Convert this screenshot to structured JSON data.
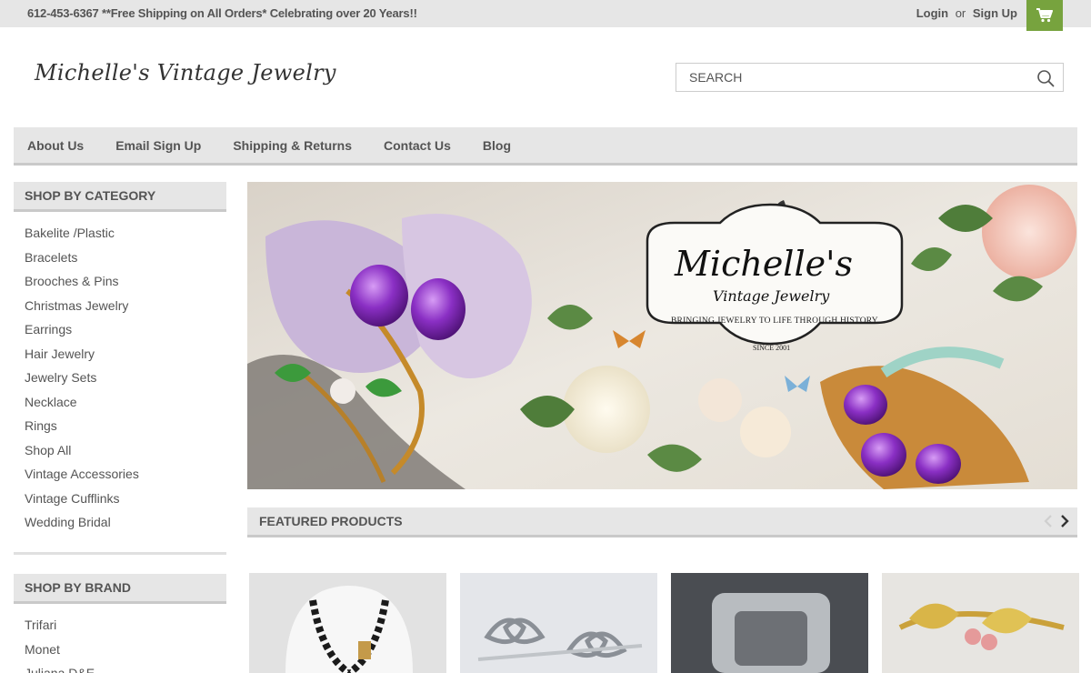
{
  "topbar": {
    "promo": "612-453-6367 **Free Shipping on All Orders* Celebrating over 20 Years!!",
    "login": "Login",
    "or": "or",
    "signup": "Sign Up"
  },
  "header": {
    "logo_text": "Michelle's Vintage Jewelry",
    "search_placeholder": "SEARCH"
  },
  "nav": {
    "items": [
      "About Us",
      "Email Sign Up",
      "Shipping & Returns",
      "Contact Us",
      "Blog"
    ]
  },
  "sidebar": {
    "category_heading": "SHOP BY CATEGORY",
    "categories": [
      "Bakelite /Plastic",
      "Bracelets",
      "Brooches & Pins",
      "Christmas Jewelry",
      "Earrings",
      "Hair Jewelry",
      "Jewelry Sets",
      "Necklace",
      "Rings",
      "Shop All",
      "Vintage Accessories",
      "Vintage Cufflinks",
      "Wedding Bridal"
    ],
    "brand_heading": "SHOP BY BRAND",
    "brands": [
      "Trifari",
      "Monet",
      "Juliana D&E"
    ]
  },
  "hero": {
    "brand_line1": "Michelle's",
    "brand_line2": "Vintage Jewelry",
    "tagline": "BRINGING JEWELRY TO LIFE THROUGH HISTORY",
    "since": "SINCE 2001"
  },
  "featured": {
    "heading": "FEATURED PRODUCTS"
  },
  "colors": {
    "cart_green": "#77a33e",
    "bar_gray": "#e6e6e6",
    "text": "#545454"
  }
}
